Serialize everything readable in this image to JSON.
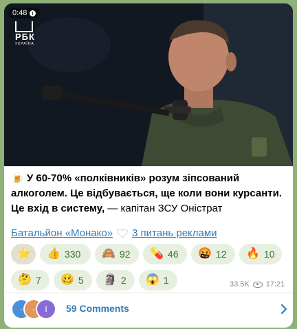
{
  "media": {
    "duration": "0:48",
    "logo_text": "РБК",
    "logo_sub": "УКРАЇНА"
  },
  "post": {
    "emoji": "🍺",
    "bold_text": "У 60-70% «полківників» розум зіпсований алкоголем. Це відбувається, ще коли вони курсанти. Це вхід в систему,",
    "plain_text": " — капітан ЗСУ Оністрат"
  },
  "links": {
    "left": "Батальйон «Монако»",
    "heart_icon": "white-heart-icon",
    "right": "3 питань реклами"
  },
  "reactions": [
    {
      "emoji": "⭐",
      "count": "",
      "icon": "star-icon"
    },
    {
      "emoji": "👍",
      "count": "330",
      "icon": "thumbs-up-icon"
    },
    {
      "emoji": "🙈",
      "count": "92",
      "icon": "see-no-evil-monkey-icon"
    },
    {
      "emoji": "💊",
      "count": "46",
      "icon": "pill-icon"
    },
    {
      "emoji": "🤬",
      "count": "12",
      "icon": "cursing-face-icon"
    },
    {
      "emoji": "🔥",
      "count": "10",
      "icon": "fire-icon"
    },
    {
      "emoji": "🤔",
      "count": "7",
      "icon": "thinking-face-icon"
    },
    {
      "emoji": "🥴",
      "count": "5",
      "icon": "woozy-face-icon"
    },
    {
      "emoji": "🗿",
      "count": "2",
      "icon": "moai-icon"
    },
    {
      "emoji": "😱",
      "count": "1",
      "icon": "screaming-face-icon"
    }
  ],
  "meta": {
    "views": "33.5K",
    "time": "17:21"
  },
  "comments": {
    "label": "59 Comments",
    "avatars": [
      "·",
      "·",
      "I"
    ]
  },
  "colors": {
    "background": "#8fb079",
    "link": "#2f7bb8",
    "reaction_chip": "#e7f0e0",
    "reaction_text": "#3a6d2f"
  }
}
